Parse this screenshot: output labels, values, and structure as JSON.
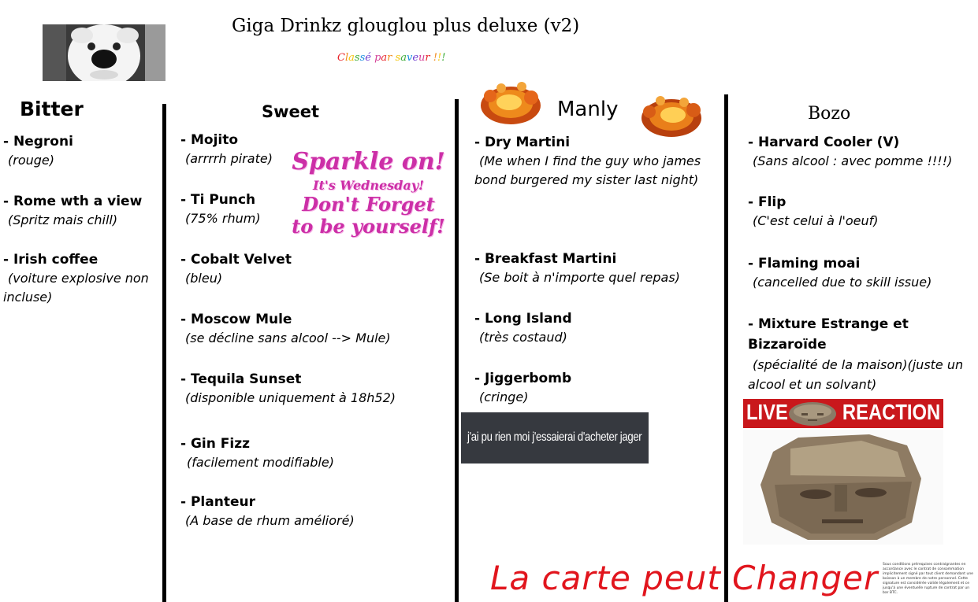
{
  "title": "Giga Drinkz glouglou plus deluxe (v2)",
  "subtitle": "Classé par saveur !!!",
  "subtitle_colors": [
    "#e8242a",
    "#f08a1c",
    "#f2c40f",
    "#3aaa35",
    "#1d8fe0",
    "#6c3bd0",
    "#d43f96"
  ],
  "images": {
    "dog": "dog-photo",
    "explosion": "explosion-icon",
    "stone_head": "stone-head-icon"
  },
  "columns": {
    "bitter": {
      "heading": "Bitter",
      "items": [
        {
          "name": "- Negroni",
          "desc": "(rouge)"
        },
        {
          "name": "- Rome wth a view",
          "desc": "(Spritz mais chill)"
        },
        {
          "name": "- Irish coffee",
          "desc": "(voiture explosive non incluse)"
        }
      ]
    },
    "sweet": {
      "heading": "Sweet",
      "items": [
        {
          "name": "- Mojito",
          "desc": "(arrrrh pirate)"
        },
        {
          "name": "- Ti Punch",
          "desc": "(75% rhum)"
        },
        {
          "name": "- Cobalt Velvet",
          "desc": "(bleu)"
        },
        {
          "name": "- Moscow Mule",
          "desc": "(se décline sans alcool --> Mule)"
        },
        {
          "name": "- Tequila Sunset",
          "desc": "(disponible uniquement à 18h52)"
        },
        {
          "name": "- Gin Fizz",
          "desc": "(facilement modifiable)"
        },
        {
          "name": "- Planteur",
          "desc": "(A base de rhum amélioré)"
        }
      ]
    },
    "manly": {
      "heading": "Manly",
      "items": [
        {
          "name": "- Dry Martini",
          "desc": "(Me when I find the guy who james bond burgered my sister last night)"
        },
        {
          "name": "- Breakfast Martini",
          "desc": "(Se boit à n'importe quel repas)"
        },
        {
          "name": "- Long Island",
          "desc": "(très costaud)"
        },
        {
          "name": "- Jiggerbomb",
          "desc": "(cringe)"
        }
      ]
    },
    "bozo": {
      "heading": "Bozo",
      "items": [
        {
          "name": "- Harvard Cooler (V)",
          "desc": "(Sans alcool : avec pomme !!!!)"
        },
        {
          "name": "- Flip",
          "desc": "(C'est celui à l'oeuf)"
        },
        {
          "name": "- Flaming moai",
          "desc": "(cancelled due to skill issue)"
        },
        {
          "name": "- Mixture Estrange et Bizzaroïde",
          "desc": "(spécialité de la maison)(juste un alcool et un solvant)"
        }
      ]
    }
  },
  "sparkle": {
    "line1": "Sparkle on!",
    "line2": "It's Wednesday!",
    "line3": "Don't Forget",
    "line4": "to be yourself!"
  },
  "jager_caption": "j'ai pu rien moi j'essaierai d'acheter jager",
  "live_reaction": {
    "live": "LIVE",
    "reaction": "REACTION"
  },
  "footer_scribble": "La carte peut Changer",
  "fine_print": "Sous conditions prérequises contraignantes en accordance avec le contrat de consommation implicitement signé par tout client demandant une boisson à un membre de notre personnel. Cette signature est considérée valide légalement et ce jusqu'à une éventuelle rupture de contrat par un bar BTC."
}
